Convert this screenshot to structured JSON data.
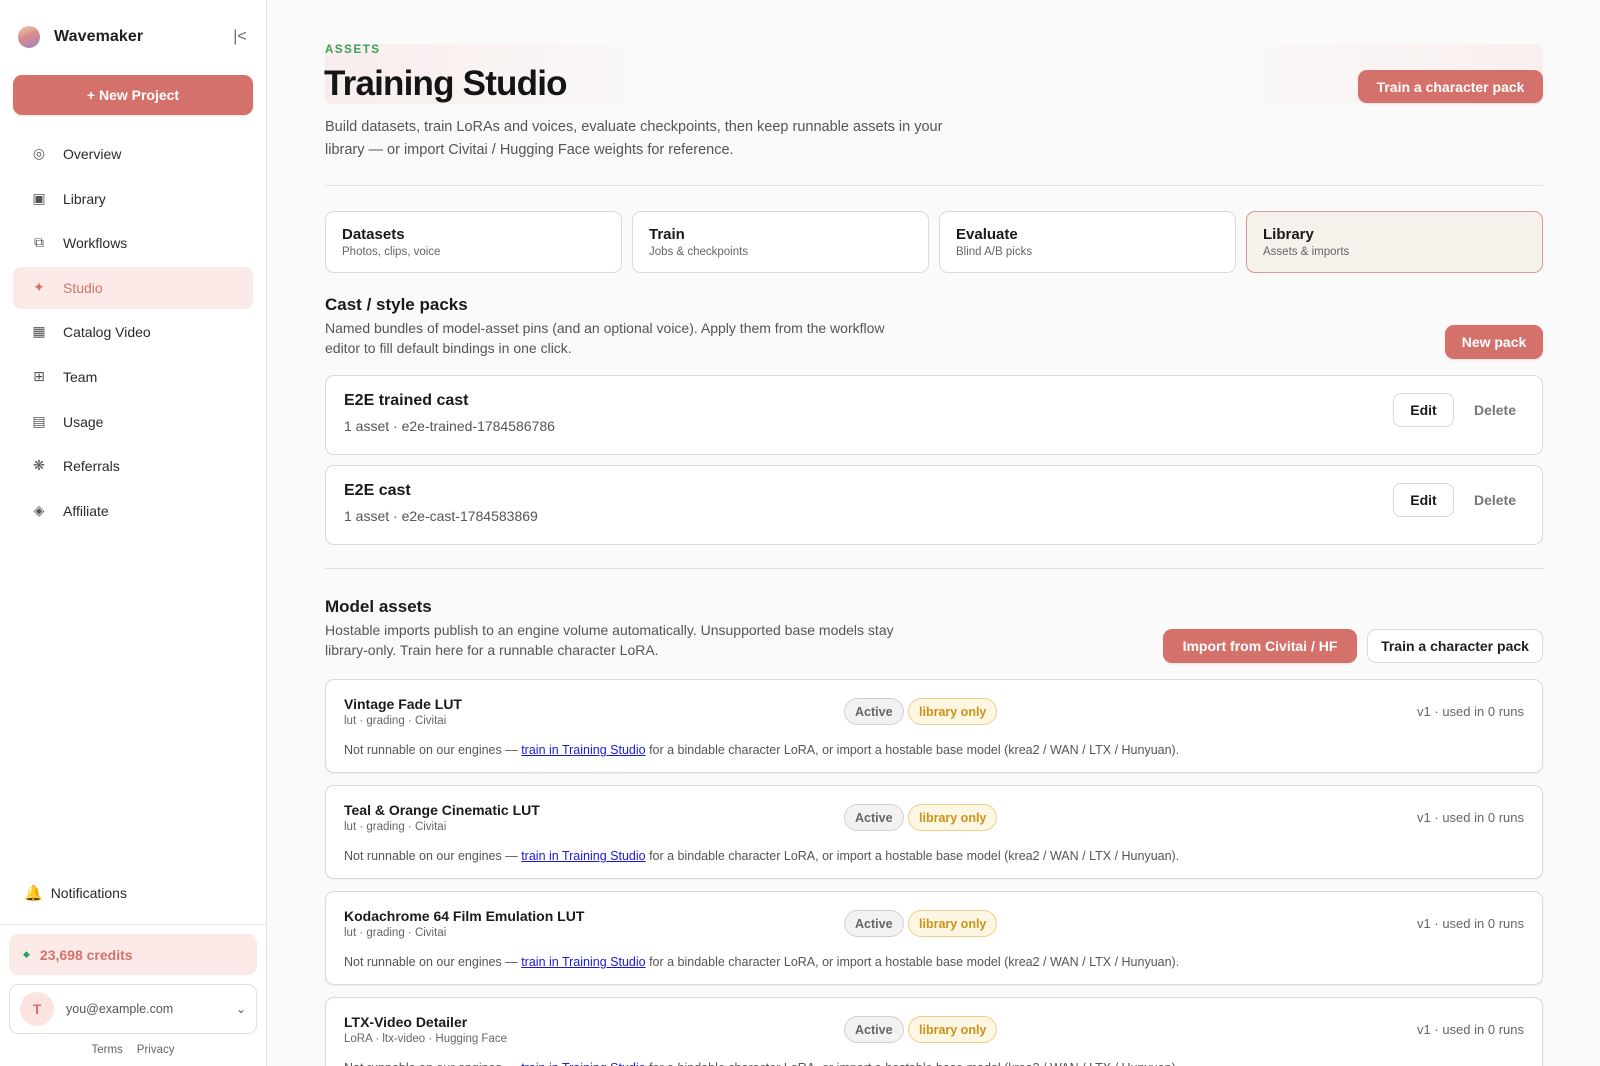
{
  "app": {
    "name": "Wavemaker",
    "collapse_icon": "collapse-sidebar-icon"
  },
  "sidebar": {
    "new_project": "+ New Project",
    "items": [
      {
        "label": "Overview",
        "icon": "◎"
      },
      {
        "label": "Library",
        "icon": "▣"
      },
      {
        "label": "Workflows",
        "icon": "⧉"
      },
      {
        "label": "Studio",
        "icon": "✦",
        "active": true
      },
      {
        "label": "Catalog Video",
        "icon": "▦"
      },
      {
        "label": "Team",
        "icon": "⊞"
      },
      {
        "label": "Usage",
        "icon": "▤"
      },
      {
        "label": "Referrals",
        "icon": "❋"
      },
      {
        "label": "Affiliate",
        "icon": "◈"
      }
    ],
    "notifications": "Notifications",
    "credits": "23,698 credits",
    "account": {
      "initial": "T",
      "email": "you@example.com"
    },
    "terms": "Terms",
    "privacy": "Privacy"
  },
  "header": {
    "eyebrow": "ASSETS",
    "title": "Training Studio",
    "description": "Build datasets, train LoRAs and voices, evaluate checkpoints, then keep runnable assets in your library — or import Civitai / Hugging Face weights for reference.",
    "cta": "Train a character pack"
  },
  "tabs": [
    {
      "label": "Datasets",
      "sub": "Photos, clips, voice"
    },
    {
      "label": "Train",
      "sub": "Jobs & checkpoints"
    },
    {
      "label": "Evaluate",
      "sub": "Blind A/B picks"
    },
    {
      "label": "Library",
      "sub": "Assets & imports",
      "active": true
    }
  ],
  "packs": {
    "title": "Cast / style packs",
    "description": "Named bundles of model-asset pins (and an optional voice). Apply them from the workflow editor to fill default bindings in one click.",
    "new_button": "New pack",
    "edit_label": "Edit",
    "delete_label": "Delete",
    "items": [
      {
        "name": "E2E trained cast",
        "meta": "1 asset · e2e-trained-1784586786"
      },
      {
        "name": "E2E cast",
        "meta": "1 asset · e2e-cast-1784583869"
      }
    ]
  },
  "assets": {
    "title": "Model assets",
    "description": "Hostable imports publish to an engine volume automatically. Unsupported base models stay library-only. Train here for a runnable character LoRA.",
    "import_button": "Import from Civitai / HF",
    "train_button": "Train a character pack",
    "active_badge": "Active",
    "library_badge": "library only",
    "note_prefix": "Not runnable on our engines — ",
    "note_link": "train in Training Studio",
    "note_suffix": " for a bindable character LoRA, or import a hostable base model (krea2 / WAN / LTX / Hunyuan).",
    "items": [
      {
        "name": "Vintage Fade LUT",
        "tags": "lut · grading · Civitai",
        "usage": "v1 · used in 0 runs"
      },
      {
        "name": "Teal & Orange Cinematic LUT",
        "tags": "lut · grading · Civitai",
        "usage": "v1 · used in 0 runs"
      },
      {
        "name": "Kodachrome 64 Film Emulation LUT",
        "tags": "lut · grading · Civitai",
        "usage": "v1 · used in 0 runs"
      },
      {
        "name": "LTX-Video Detailer",
        "tags": "LoRA · ltx-video · Hugging Face",
        "usage": "v1 · used in 0 runs"
      }
    ]
  },
  "colors": {
    "accent": "#d4716a",
    "eyebrow": "#3aa05a",
    "library_badge": "#c9931a",
    "link": "#1a1ad6"
  }
}
